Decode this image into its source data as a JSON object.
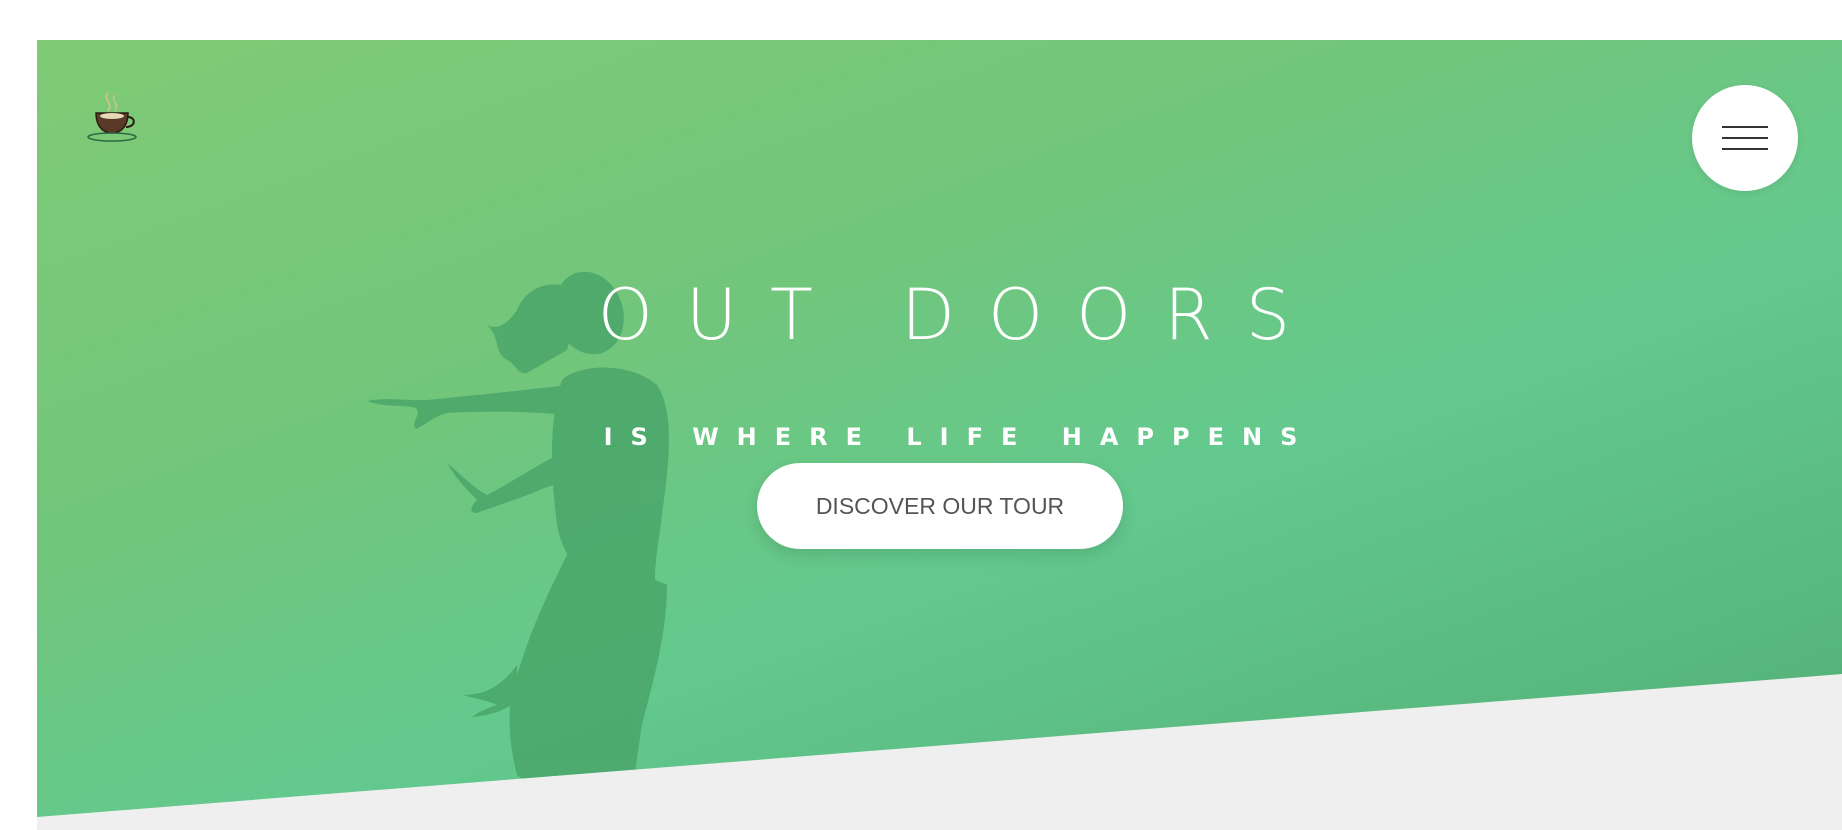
{
  "header": {
    "logo_icon": "coffee-cup-icon",
    "menu_icon": "hamburger-menu-icon"
  },
  "hero": {
    "title": "OUT DOORS",
    "subtitle": "IS WHERE LIFE HAPPENS",
    "cta_label": "DISCOVER OUR TOUR",
    "image": "dancing-woman-silhouette"
  },
  "colors": {
    "gradient_start": "#7fcb76",
    "gradient_mid": "#63c98e",
    "gradient_end": "#52ad74",
    "section_background": "#efefef",
    "text": "#ffffff",
    "button_text": "#555555"
  }
}
